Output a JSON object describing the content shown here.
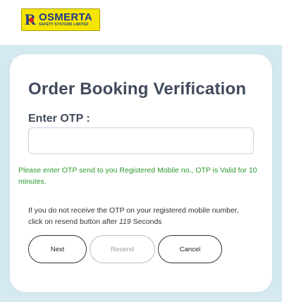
{
  "logo": {
    "name": "OSMERTA",
    "mark": "R",
    "subtitle": "SAFETY SYSTEMS LIMITED"
  },
  "form": {
    "title": "Order Booking Verification",
    "otp_label": "Enter OTP :",
    "otp_value": "",
    "otp_placeholder": "",
    "validity_message": "Please enter OTP send to you Registered Mobile no., OTP is Valid for 10 minutes.",
    "resend_prefix": "If you do not receive the OTP on your registered mobile number, click on resend button after ",
    "resend_seconds": "119",
    "resend_suffix": " Seconds"
  },
  "buttons": {
    "next": "Next",
    "resend": "Resend",
    "cancel": "Cancel"
  },
  "colors": {
    "background": "#d5e9f1",
    "title": "#414a5c",
    "message": "#2a9b2a",
    "logo_bg": "#f5e500",
    "logo_text": "#1f3a8a"
  }
}
